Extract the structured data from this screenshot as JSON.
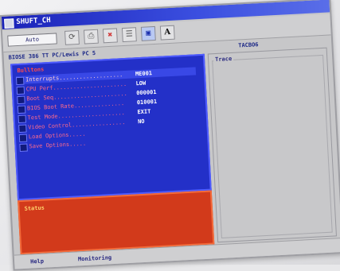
{
  "window": {
    "title": "SHUFT_CH"
  },
  "toolbar": {
    "mode_value": "Auto",
    "buttons": [
      {
        "icon": "refresh-icon",
        "glyph": "⟳"
      },
      {
        "icon": "printer-icon",
        "glyph": "⎙"
      },
      {
        "icon": "stop-icon",
        "glyph": "✖"
      },
      {
        "icon": "list-icon",
        "glyph": "☰"
      },
      {
        "icon": "window-icon",
        "glyph": "▣"
      },
      {
        "icon": "font-icon",
        "glyph": "A"
      }
    ]
  },
  "header": {
    "left": "BIOSE 386 TT PC/Lewis PC 5",
    "right": "TACBO6"
  },
  "left_panel": {
    "title": "Bulltons",
    "items": [
      {
        "label": "Interrupts...................",
        "value": "ME001"
      },
      {
        "label": "CPU Perf......................",
        "value": "LOW"
      },
      {
        "label": "Boot Seq......................",
        "value": "000001"
      },
      {
        "label": "BIOS Boot Rate...............",
        "value": "010001"
      },
      {
        "label": "Test Mode....................",
        "value": "EXIT"
      },
      {
        "label": "Video Control................",
        "value": "NO"
      },
      {
        "label": "Load Options.....",
        "value": ""
      },
      {
        "label": "Save Options.....",
        "value": ""
      }
    ]
  },
  "status_panel": {
    "title": "Status"
  },
  "right_panel": {
    "label": "Trace"
  },
  "bottom": {
    "help": "Help",
    "monitoring": "Monitoring"
  },
  "colors": {
    "titlebar": "#1a22b8",
    "menu_panel": "#2330c8",
    "status_panel": "#d23a1b",
    "menu_text": "#ff6a8a"
  }
}
